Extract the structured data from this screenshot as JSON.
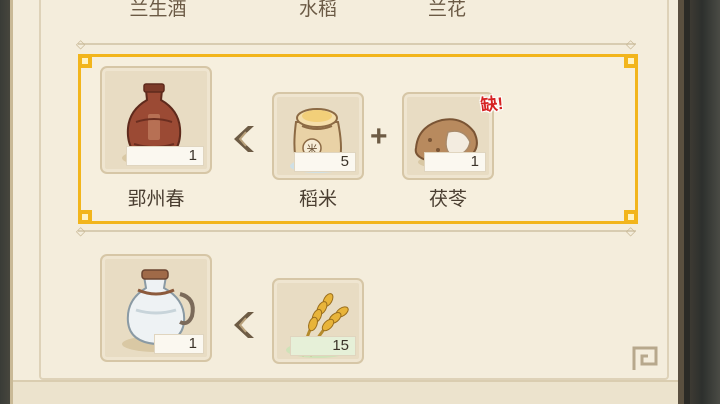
{
  "top_row": {
    "labels": [
      "兰生酒",
      "水稻",
      "兰花"
    ]
  },
  "recipe_1": {
    "product": {
      "name": "郢州春",
      "count": "1",
      "icon": "wine-jar-icon"
    },
    "ingredients": [
      {
        "name": "稻米",
        "count": "5",
        "icon": "rice-sack-icon"
      },
      {
        "name": "茯苓",
        "count": "1",
        "icon": "poria-icon",
        "missing_label": "缺!"
      }
    ],
    "highlight_color": "#f2b51c"
  },
  "recipe_2": {
    "product": {
      "count": "1",
      "icon": "white-wine-pot-icon"
    },
    "ingredients": [
      {
        "count": "15",
        "icon": "rice-stalk-icon"
      }
    ]
  }
}
